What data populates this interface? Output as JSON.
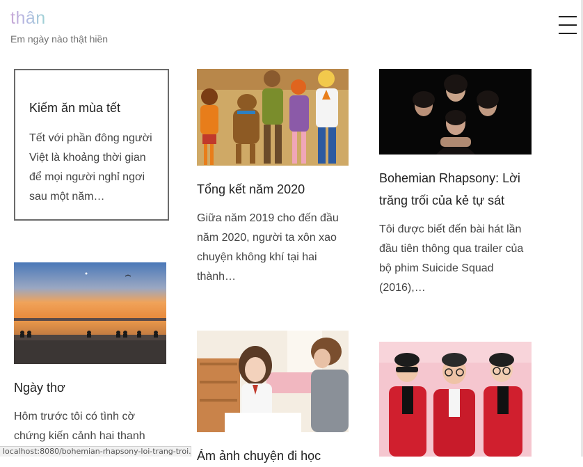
{
  "site": {
    "title": "thân",
    "description": "Em ngày nào thật hiền"
  },
  "menu": {
    "icon": "hamburger-menu-icon"
  },
  "posts": [
    {
      "title": "Kiếm ăn mùa tết",
      "excerpt": "Tết với phần đông người Việt là khoảng thời gian để mọi người nghỉ ngơi sau một năm…"
    },
    {
      "title": "Tổng kết năm 2020",
      "excerpt": "Giữa năm 2019 cho đến đầu năm 2020, người ta xôn xao chuyện không khí tại hai thành…"
    },
    {
      "title": "Bohemian Rhapsony: Lời trăng trối của kẻ tự sát",
      "excerpt": "Tôi được biết đến bài hát lần đầu tiên thông qua trailer của bộ phim Suicide Squad (2016),…"
    },
    {
      "title": "Ngày thơ",
      "excerpt": "Hôm trước tôi có tình cờ chứng kiến cảnh hai thanh"
    },
    {
      "title": "Ám ảnh chuyện đi học",
      "excerpt": ""
    },
    {
      "title": "",
      "excerpt": ""
    }
  ],
  "status_bar": {
    "url": "localhost:8080/bohemian-rhapsony-loi-trang-troi..."
  }
}
